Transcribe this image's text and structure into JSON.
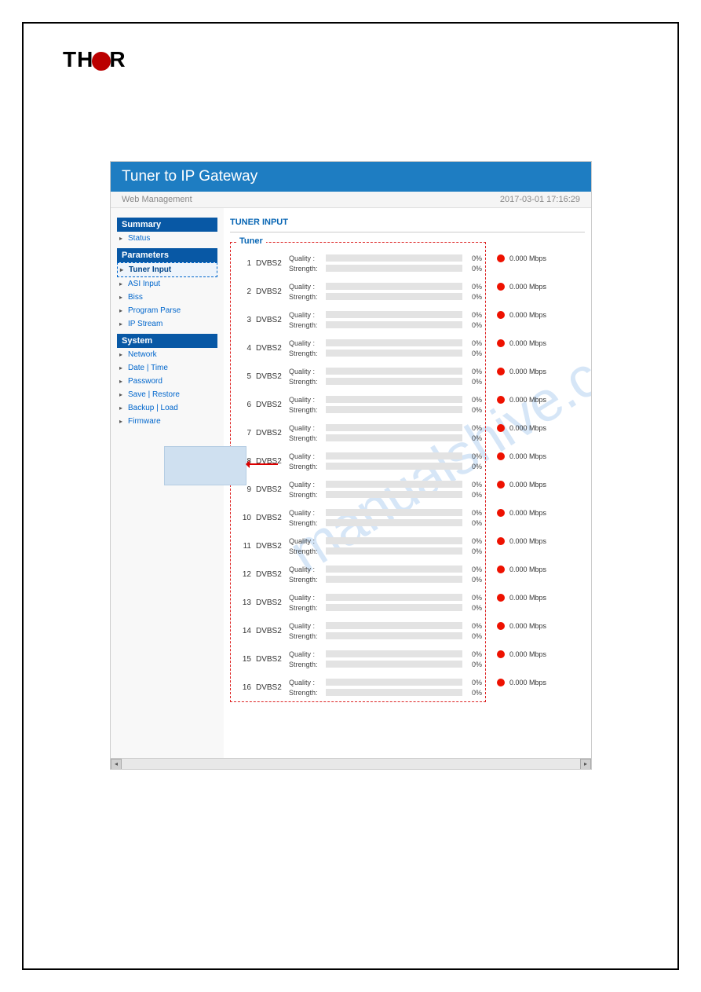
{
  "logo_text_left": "TH",
  "logo_text_right": "R",
  "app": {
    "title": "Tuner to IP Gateway",
    "subtitle": "Web Management",
    "timestamp": "2017-03-01 17:16:29"
  },
  "sidebar": {
    "sections": [
      {
        "heading": "Summary",
        "items": [
          "Status"
        ]
      },
      {
        "heading": "Parameters",
        "items": [
          "Tuner Input",
          "ASI Input",
          "Biss",
          "Program Parse",
          "IP Stream"
        ]
      },
      {
        "heading": "System",
        "items": [
          "Network",
          "Date | Time",
          "Password",
          "Save | Restore",
          "Backup | Load",
          "Firmware"
        ]
      }
    ],
    "active": "Tuner Input"
  },
  "main": {
    "title": "TUNER INPUT",
    "group_label": "Tuner",
    "quality_label": "Quality :",
    "strength_label": "Strength:",
    "rows": [
      {
        "idx": 1,
        "type": "DVBS2",
        "quality": "0%",
        "strength": "0%",
        "rate": "0.000 Mbps"
      },
      {
        "idx": 2,
        "type": "DVBS2",
        "quality": "0%",
        "strength": "0%",
        "rate": "0.000 Mbps"
      },
      {
        "idx": 3,
        "type": "DVBS2",
        "quality": "0%",
        "strength": "0%",
        "rate": "0.000 Mbps"
      },
      {
        "idx": 4,
        "type": "DVBS2",
        "quality": "0%",
        "strength": "0%",
        "rate": "0.000 Mbps"
      },
      {
        "idx": 5,
        "type": "DVBS2",
        "quality": "0%",
        "strength": "0%",
        "rate": "0.000 Mbps"
      },
      {
        "idx": 6,
        "type": "DVBS2",
        "quality": "0%",
        "strength": "0%",
        "rate": "0.000 Mbps"
      },
      {
        "idx": 7,
        "type": "DVBS2",
        "quality": "0%",
        "strength": "0%",
        "rate": "0.000 Mbps"
      },
      {
        "idx": 8,
        "type": "DVBS2",
        "quality": "0%",
        "strength": "0%",
        "rate": "0.000 Mbps"
      },
      {
        "idx": 9,
        "type": "DVBS2",
        "quality": "0%",
        "strength": "0%",
        "rate": "0.000 Mbps"
      },
      {
        "idx": 10,
        "type": "DVBS2",
        "quality": "0%",
        "strength": "0%",
        "rate": "0.000 Mbps"
      },
      {
        "idx": 11,
        "type": "DVBS2",
        "quality": "0%",
        "strength": "0%",
        "rate": "0.000 Mbps"
      },
      {
        "idx": 12,
        "type": "DVBS2",
        "quality": "0%",
        "strength": "0%",
        "rate": "0.000 Mbps"
      },
      {
        "idx": 13,
        "type": "DVBS2",
        "quality": "0%",
        "strength": "0%",
        "rate": "0.000 Mbps"
      },
      {
        "idx": 14,
        "type": "DVBS2",
        "quality": "0%",
        "strength": "0%",
        "rate": "0.000 Mbps"
      },
      {
        "idx": 15,
        "type": "DVBS2",
        "quality": "0%",
        "strength": "0%",
        "rate": "0.000 Mbps"
      },
      {
        "idx": 16,
        "type": "DVBS2",
        "quality": "0%",
        "strength": "0%",
        "rate": "0.000 Mbps"
      }
    ]
  },
  "watermark": "manualshive.com"
}
